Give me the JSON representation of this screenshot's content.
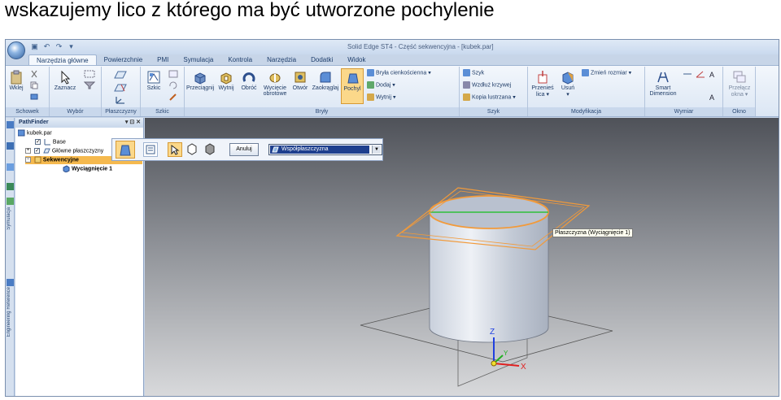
{
  "slide": {
    "title": "wskazujemy lico z którego ma być utworzone pochylenie"
  },
  "window": {
    "title": "Solid Edge ST4 - Część sekwencyjna - [kubek.par]"
  },
  "tabs": [
    "Narzędzia główne",
    "Powierzchnie",
    "PMI",
    "Symulacja",
    "Kontrola",
    "Narzędzia",
    "Dodatki",
    "Widok"
  ],
  "ribbon": {
    "schowek": {
      "label": "Schowek",
      "wklej": "Wklej"
    },
    "wybor": {
      "label": "Wybór",
      "zaznacz": "Zaznacz"
    },
    "plaszczyzny": {
      "label": "Płaszczyzny"
    },
    "szkic": {
      "label": "Szkic",
      "szkic_btn": "Szkic"
    },
    "bryly": {
      "label": "Bryły",
      "przeciagnij": "Przeciągnij",
      "wytnij": "Wytnij",
      "obroc": "Obróć",
      "wyciecie1": "Wycięcie",
      "wyciecie2": "obrotowe",
      "otwor": "Otwór",
      "zaokraglaj": "Zaokrąglaj",
      "pochyl": "Pochyl",
      "bryla_cienkoscienna": "Bryła cienkościenna",
      "dodaj": "Dodaj",
      "wytnij_small": "Wytnij"
    },
    "szyk": {
      "label": "Szyk",
      "szyk_btn": "Szyk",
      "wzdluz": "Wzdłuż krzywej",
      "kopia": "Kopia lustrzana"
    },
    "modyfikacja": {
      "label": "Modyfikacja",
      "przenies1": "Przenieś",
      "przenies2": "lica",
      "usun": "Usuń",
      "zmien": "Zmień rozmiar"
    },
    "wymiar": {
      "label": "Wymiar",
      "smart1": "Smart",
      "smart2": "Dimension"
    },
    "okno": {
      "label": "Okno",
      "przelacz1": "Przełącz",
      "przelacz2": "okna"
    }
  },
  "pathfinder": {
    "title": "PathFinder",
    "items": [
      {
        "label": "kubek.par"
      },
      {
        "label": "Base"
      },
      {
        "label": "Główne płaszczyzny"
      },
      {
        "label": "Sekwencyjne"
      },
      {
        "label": "Wyciągnięcie 1"
      }
    ]
  },
  "side_tabs": {
    "symulacja": "Symulacja",
    "engineering": "Engineering Reference"
  },
  "command_bar": {
    "cancel": "Anuluj",
    "plane_option": "Współpłaszczyzna"
  },
  "tooltip": "Płaszczyzna (Wyciągnięcie 1)",
  "axes": {
    "x": "X",
    "y": "Y",
    "z": "Z"
  },
  "colors": {
    "highlight": "#f29a3a",
    "edge_green": "#2fbf3a",
    "axis_x": "#e02020",
    "axis_y": "#20b020",
    "axis_z": "#2040e0"
  }
}
